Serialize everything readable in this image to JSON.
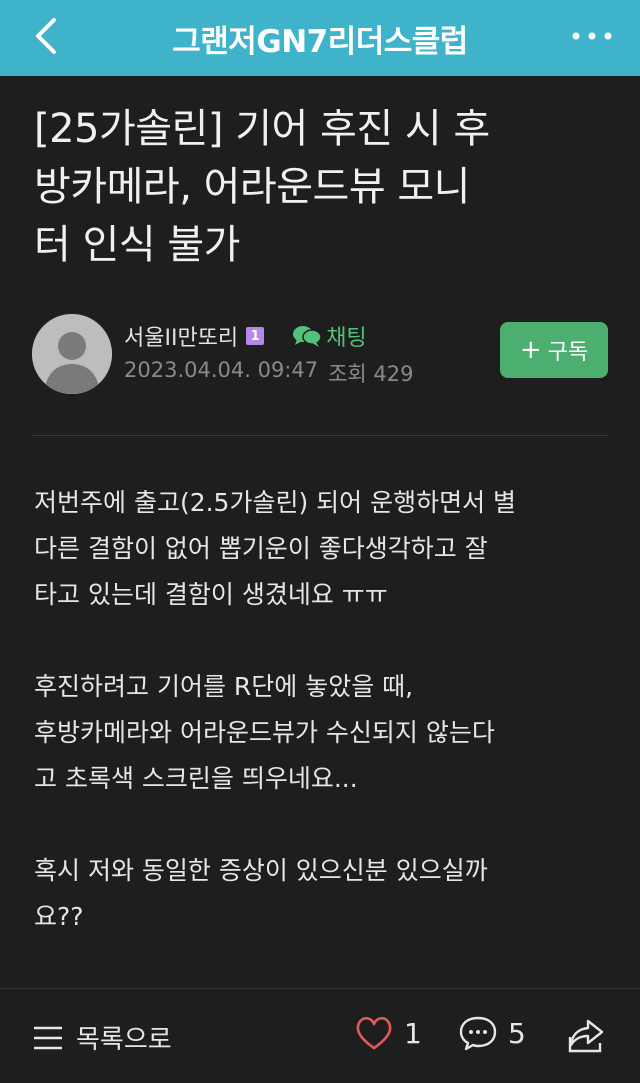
{
  "header": {
    "title": "그랜저GN7리더스클럽",
    "background": "#3fb3c9"
  },
  "post": {
    "title_lines": [
      "[25가솔린] 기어 후진 시 후",
      "방카메라, 어라운드뷰 모니",
      "터 인식 불가"
    ],
    "author": "서울II만또리",
    "level": "1",
    "chat_label": "채팅",
    "date": "2023.04.04. 09:47",
    "views": "조회 429",
    "subscribe_label": "구독",
    "body": [
      "저번주에 출고(2.5가솔린) 되어 운행하면서 별",
      "다른 결함이 없어 뽑기운이 좋다생각하고 잘",
      "타고 있는데 결함이 생겼네요 ㅠㅠ",
      "후진하려고 기어를 R단에 놓았을 때,",
      "후방카메라와 어라운드뷰가 수신되지 않는다",
      "고 초록색 스크린을 띄우네요...",
      "혹시 저와 동일한 증상이 있으신분 있으실까",
      "요??"
    ]
  },
  "bottom": {
    "list_label": "목록으로",
    "like_count": "1",
    "comment_count": "5"
  },
  "colors": {
    "accent_green": "#4caf6f",
    "like_red": "#e05a5a"
  }
}
